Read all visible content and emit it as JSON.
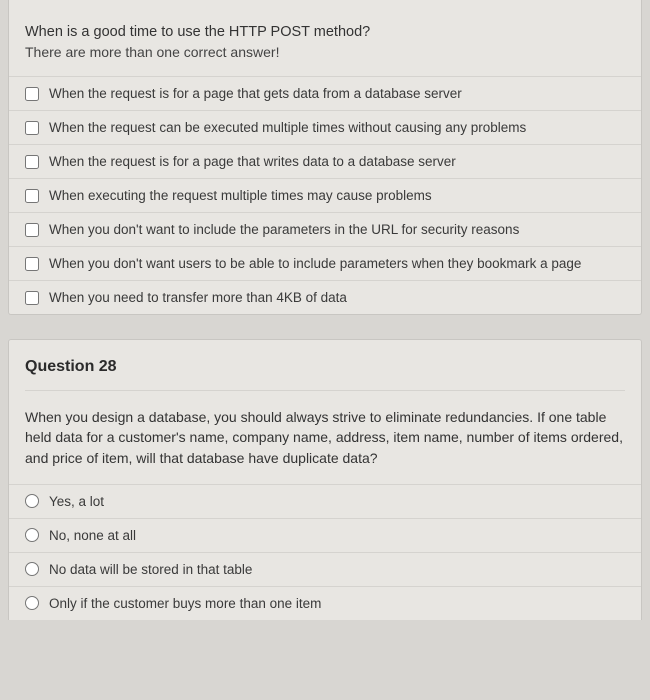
{
  "q27": {
    "heading": "When is a good time to use the HTTP POST method?",
    "note": "There are more than one correct answer!",
    "options": [
      "When the request is for a page that gets data from a database server",
      "When the request can be executed multiple times without causing any problems",
      "When the request is for a page that writes data to a database server",
      "When executing the request multiple times may cause problems",
      "When you don't want to include the parameters in the URL for security reasons",
      "When you don't want users to be able to include parameters when they bookmark a page",
      "When you need to transfer more than 4KB of data"
    ]
  },
  "q28": {
    "label": "Question 28",
    "text": "When you design a database, you should always strive to eliminate redundancies.  If one table held data for a customer's name, company name, address, item name, number of items ordered, and price of item, will that database have duplicate data?",
    "options": [
      "Yes, a lot",
      "No, none at all",
      "No data will be stored in that table",
      "Only if the customer buys more than one item"
    ]
  }
}
